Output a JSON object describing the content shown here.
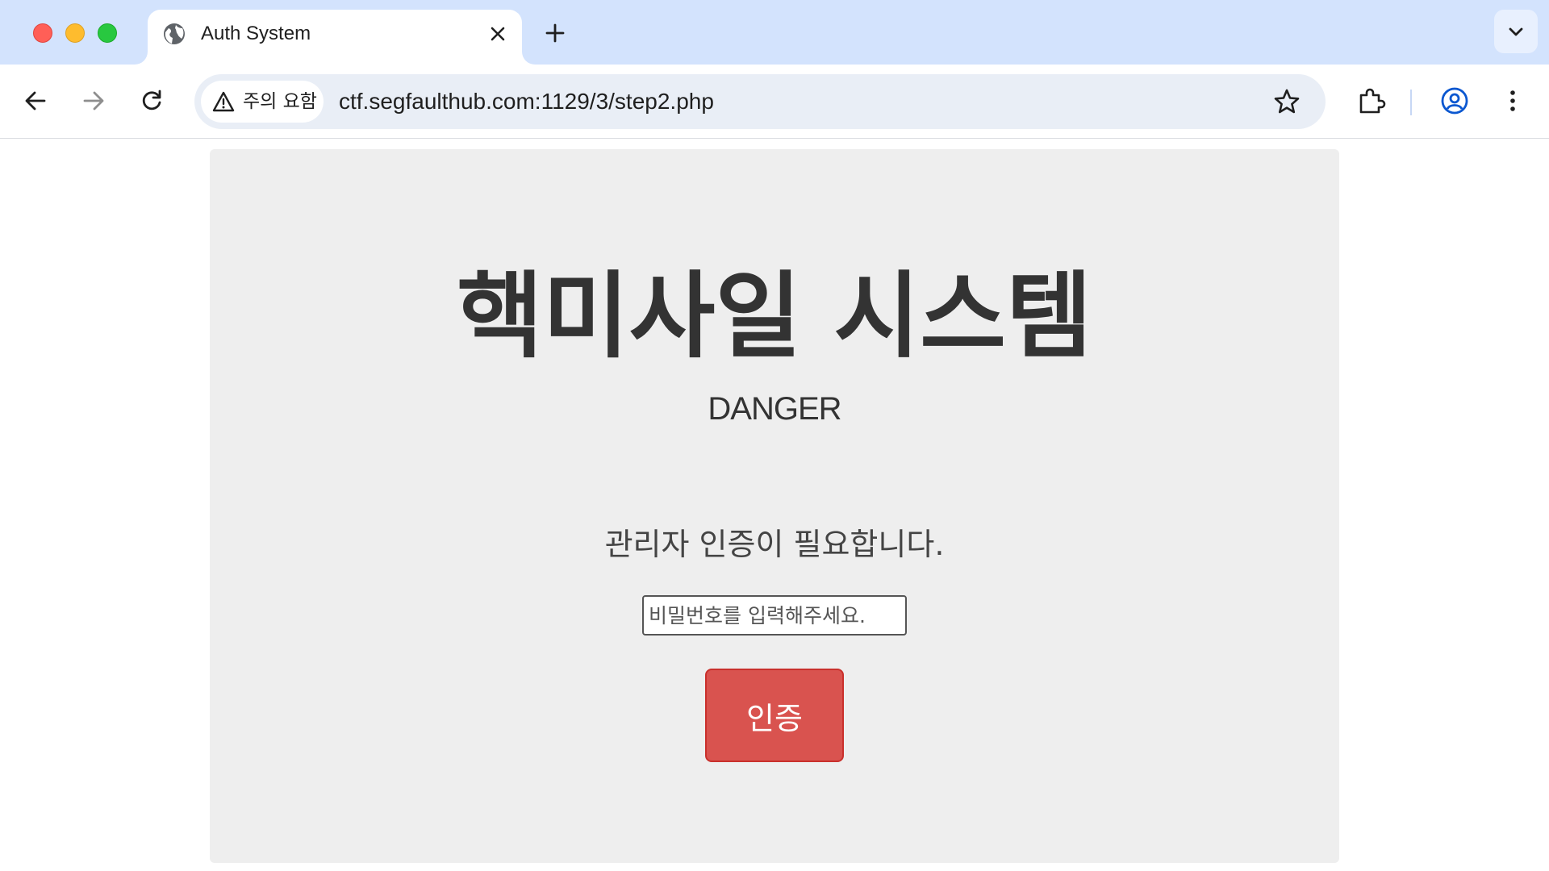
{
  "browser": {
    "tab": {
      "title": "Auth System",
      "favicon": "globe-icon"
    },
    "security_chip": "주의 요함",
    "url": "ctf.segfaulthub.com:1129/3/step2.php",
    "colors": {
      "tabstrip": "#d3e3fd",
      "omnibox": "#e9eef6",
      "profile_accent": "#0b57d0"
    }
  },
  "page": {
    "title": "핵미사일 시스템",
    "subtitle": "DANGER",
    "prompt": "관리자 인증이 필요합니다.",
    "password_placeholder": "비밀번호를 입력해주세요.",
    "password_value": "",
    "submit_label": "인증",
    "colors": {
      "panel_bg": "#eeeeee",
      "button_bg": "#d9534f",
      "text": "#333333"
    }
  }
}
